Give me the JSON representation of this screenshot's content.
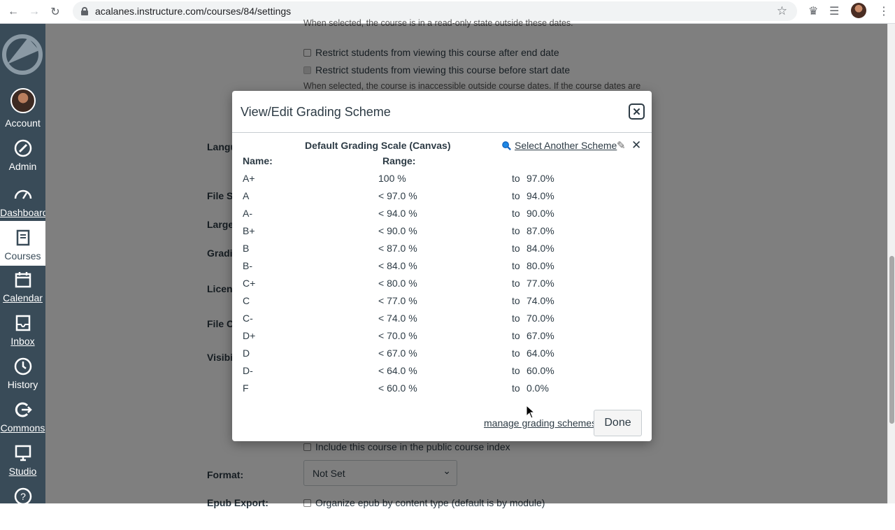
{
  "browser": {
    "url": "acalanes.instructure.com/courses/84/settings"
  },
  "sidebar": {
    "items": [
      {
        "label": "Account"
      },
      {
        "label": "Admin"
      },
      {
        "label": "Dashboard"
      },
      {
        "label": "Courses"
      },
      {
        "label": "Calendar"
      },
      {
        "label": "Inbox"
      },
      {
        "label": "History"
      },
      {
        "label": "Commons"
      },
      {
        "label": "Studio"
      }
    ]
  },
  "background": {
    "top_cut_text": "When selected, the course is in a read-only state outside these dates.",
    "restrict_after": "Restrict students from viewing this course after end date",
    "restrict_before": "Restrict students from viewing this course before start date",
    "inaccessible_note": "When selected, the course is inaccessible outside course dates. If the course dates are",
    "labels": [
      "Langu",
      "File St",
      "Large",
      "Gradi",
      "Licens",
      "File C",
      "Visibi"
    ],
    "public_index": "Include this course in the public course index",
    "format_label": "Format:",
    "format_value": "Not Set",
    "epub_label": "Epub Export:",
    "epub_option": "Organize epub by content type (default is by module)"
  },
  "dialog": {
    "title": "View/Edit Grading Scheme",
    "scheme_name": "Default Grading Scale (Canvas)",
    "select_another": "Select Another Scheme",
    "col_name": "Name:",
    "col_range": "Range:",
    "to_word": "to",
    "rows": [
      {
        "name": "A+",
        "from": "100 %",
        "to": "97.0%"
      },
      {
        "name": "A",
        "from": "< 97.0 %",
        "to": "94.0%"
      },
      {
        "name": "A-",
        "from": "< 94.0 %",
        "to": "90.0%"
      },
      {
        "name": "B+",
        "from": "< 90.0 %",
        "to": "87.0%"
      },
      {
        "name": "B",
        "from": "< 87.0 %",
        "to": "84.0%"
      },
      {
        "name": "B-",
        "from": "< 84.0 %",
        "to": "80.0%"
      },
      {
        "name": "C+",
        "from": "< 80.0 %",
        "to": "77.0%"
      },
      {
        "name": "C",
        "from": "< 77.0 %",
        "to": "74.0%"
      },
      {
        "name": "C-",
        "from": "< 74.0 %",
        "to": "70.0%"
      },
      {
        "name": "D+",
        "from": "< 70.0 %",
        "to": "67.0%"
      },
      {
        "name": "D",
        "from": "< 67.0 %",
        "to": "64.0%"
      },
      {
        "name": "D-",
        "from": "< 64.0 %",
        "to": "60.0%"
      },
      {
        "name": "F",
        "from": "< 60.0 %",
        "to": "0.0%"
      }
    ],
    "manage_link": "manage grading schemes",
    "done_label": "Done"
  }
}
